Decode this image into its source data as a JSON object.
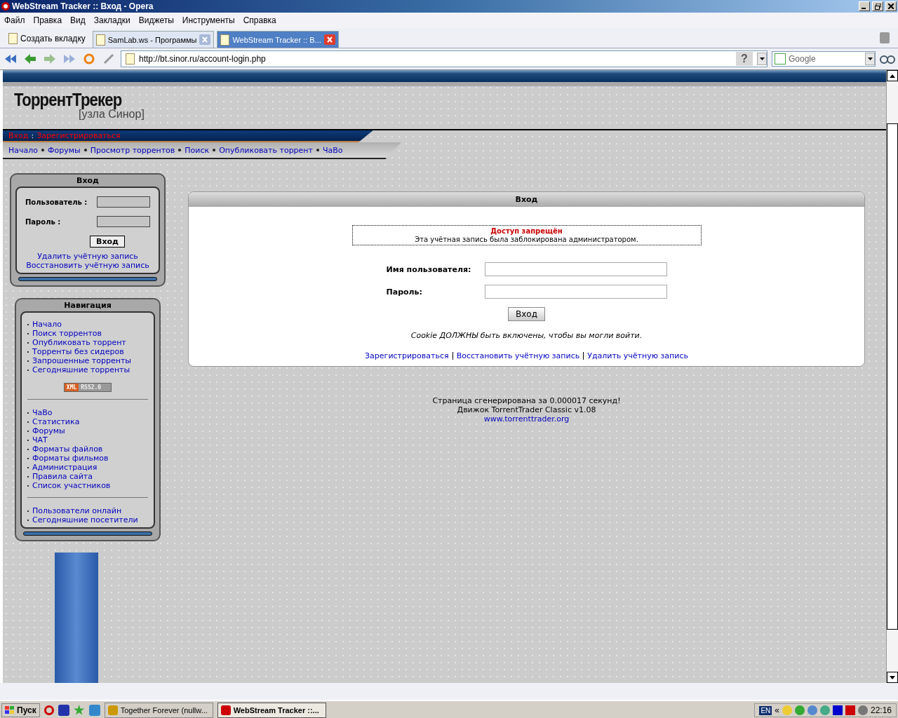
{
  "window": {
    "title": "WebStream Tracker :: Вход - Opera"
  },
  "menu": [
    "Файл",
    "Правка",
    "Вид",
    "Закладки",
    "Виджеты",
    "Инструменты",
    "Справка"
  ],
  "tabs": {
    "new_tab": "Создать вкладку",
    "items": [
      {
        "label": "SamLab.ws - Программы",
        "selected": false
      },
      {
        "label": "WebStream Tracker :: В...",
        "selected": true
      }
    ]
  },
  "address_bar": {
    "url": "http://bt.sinor.ru/account-login.php",
    "help": "?",
    "search_placeholder": "Google"
  },
  "site": {
    "logo_title": "ТоррентТрекер",
    "logo_subtitle": "[узла Синор]",
    "user_links": [
      "Вход",
      "Зарегистрироваться"
    ],
    "user_links_separator": ":",
    "nav_links": [
      "Начало",
      "Форумы",
      "Просмотр торрентов",
      "Поиск",
      "Опубликовать торрент",
      "ЧаВо"
    ]
  },
  "sidebar_login": {
    "title": "Вход",
    "username_label": "Пользователь :",
    "password_label": "Пароль :",
    "button": "Вход",
    "links": [
      "Удалить учётную запись",
      "Восстановить учётную запись"
    ]
  },
  "navigation": {
    "title": "Навигация",
    "groups": [
      [
        "Начало",
        "Поиск торрентов",
        "Опубликовать торрент",
        "Торренты без сидеров",
        "Запрошенные торренты",
        "Сегодняшние торренты"
      ],
      [
        "ЧаВо",
        "Статистика",
        "Форумы",
        "ЧАТ",
        "Форматы файлов",
        "Форматы фильмов",
        "Администрация",
        "Правила сайта",
        "Список участников"
      ],
      [
        "Пользователи онлайн",
        "Сегодняшние посетители"
      ]
    ],
    "rss_badge": {
      "left": "XML",
      "right": "RSS2.0"
    }
  },
  "login_panel": {
    "title": "Вход",
    "error_title": "Доступ запрещён",
    "error_text": "Эта учётная запись была заблокирована администратором.",
    "username_label": "Имя пользователя:",
    "password_label": "Пароль:",
    "button": "Вход",
    "cookie_note": "Cookie ДОЛЖНЫ быть включены, чтобы вы могли войти.",
    "links": [
      "Зарегистрироваться",
      "Восстановить учётную запись",
      "Удалить учётную запись"
    ]
  },
  "footer": {
    "lines": [
      "Страница сгенерирована за 0.000017 секунд!",
      "Движок TorrentTrader Classic v1.08"
    ],
    "link": "www.torrenttrader.org"
  },
  "taskbar": {
    "start": "Пуск",
    "tasks": [
      {
        "label": "Together Forever (nullw...",
        "selected": false
      },
      {
        "label": "WebStream Tracker ::...",
        "selected": true
      }
    ],
    "language": "EN",
    "expand": "«",
    "clock": "22:16"
  }
}
